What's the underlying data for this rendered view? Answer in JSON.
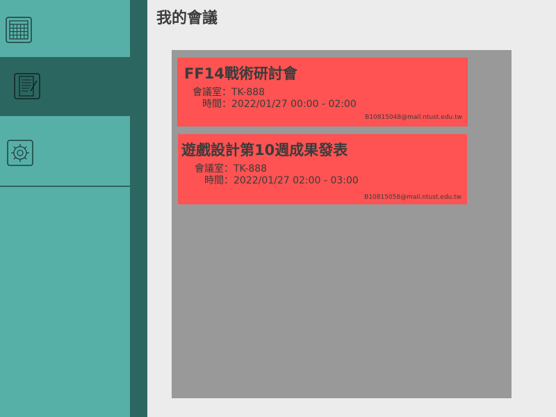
{
  "sidebar": {
    "items": [
      {
        "name": "calendar",
        "icon": "calendar-icon",
        "active": false
      },
      {
        "name": "meetings",
        "icon": "notepad-icon",
        "active": true
      },
      {
        "name": "settings",
        "icon": "gear-icon",
        "active": false
      }
    ]
  },
  "header": {
    "title": "我的會議"
  },
  "meetings": [
    {
      "title": "FF14戰術研討會",
      "room_label": "會議室：",
      "room": "TK-888",
      "time_label": "時間：",
      "time": "2022/01/27  00:00 - 02:00",
      "email": "B10815048@mail.ntust.edu.tw"
    },
    {
      "title": "遊戲設計第10週成果發表",
      "room_label": "會議室：",
      "room": "TK-888",
      "time_label": "時間：",
      "time": "2022/01/27  02:00 - 03:00",
      "email": "B10815058@mail.ntust.edu.tw"
    }
  ],
  "colors": {
    "sidebar_dark": "#2c6660",
    "sidebar_light": "#57b0a8",
    "page_bg": "#ececec",
    "panel_bg": "#999999",
    "card_bg": "#ff5252"
  }
}
